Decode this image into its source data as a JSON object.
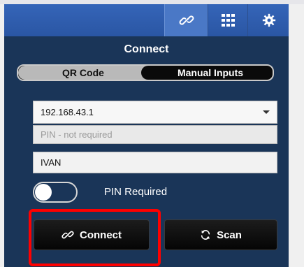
{
  "toolbar": {
    "items": [
      {
        "icon": "link-icon"
      },
      {
        "icon": "grid-icon"
      },
      {
        "icon": "gear-icon"
      }
    ]
  },
  "connect": {
    "title": "Connect",
    "mode_tabs": [
      {
        "label": "QR Code",
        "selected": false
      },
      {
        "label": "Manual Inputs",
        "selected": true
      }
    ],
    "ip_address": {
      "value": "192.168.43.1"
    },
    "pin": {
      "value": "",
      "placeholder": "PIN - not required"
    },
    "name": {
      "value": "IVAN"
    },
    "pin_required": {
      "label": "PIN Required",
      "on": false
    },
    "buttons": {
      "connect_label": "Connect",
      "scan_label": "Scan"
    }
  },
  "colors": {
    "panel": "#1a3558",
    "toolbar": "#2f5eb0",
    "highlight": "#ff0000"
  }
}
